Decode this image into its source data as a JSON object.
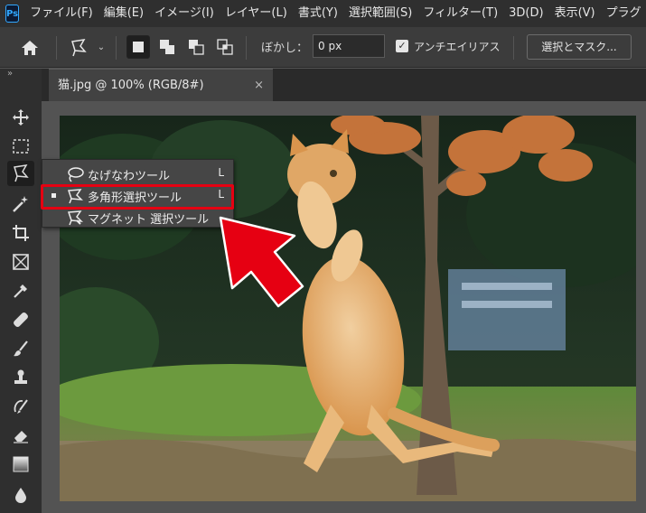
{
  "app": {
    "logo_text": "Ps"
  },
  "menu": [
    "ファイル(F)",
    "編集(E)",
    "イメージ(I)",
    "レイヤー(L)",
    "書式(Y)",
    "選択範囲(S)",
    "フィルター(T)",
    "3D(D)",
    "表示(V)",
    "プラグ"
  ],
  "options": {
    "feather_label": "ぼかし：",
    "feather_value": "0 px",
    "antialias_label": "アンチエイリアス",
    "antialias_checked": true,
    "select_mask_label": "選択とマスク..."
  },
  "toolbar": {
    "grip": "»",
    "tools": [
      "move-icon",
      "marquee-icon",
      "lasso-icon",
      "magic-wand-icon",
      "crop-icon",
      "frame-icon",
      "eyedropper-icon",
      "healing-brush-icon",
      "brush-icon",
      "clone-stamp-icon",
      "history-brush-icon",
      "eraser-icon",
      "gradient-icon",
      "blur-icon"
    ]
  },
  "document": {
    "tab_title": "猫.jpg @ 100% (RGB/8#)",
    "close_glyph": "×"
  },
  "flyout": {
    "items": [
      {
        "label": "なげなわツール",
        "shortcut": "L",
        "icon": "lasso-icon",
        "selected": false
      },
      {
        "label": "多角形選択ツール",
        "shortcut": "L",
        "icon": "polygonal-lasso-icon",
        "selected": true
      },
      {
        "label": "マグネット 選択ツール",
        "shortcut": "",
        "icon": "magnetic-lasso-icon",
        "selected": false
      }
    ]
  },
  "colors": {
    "highlight_box": "#e60012",
    "arrow": "#e60012"
  }
}
